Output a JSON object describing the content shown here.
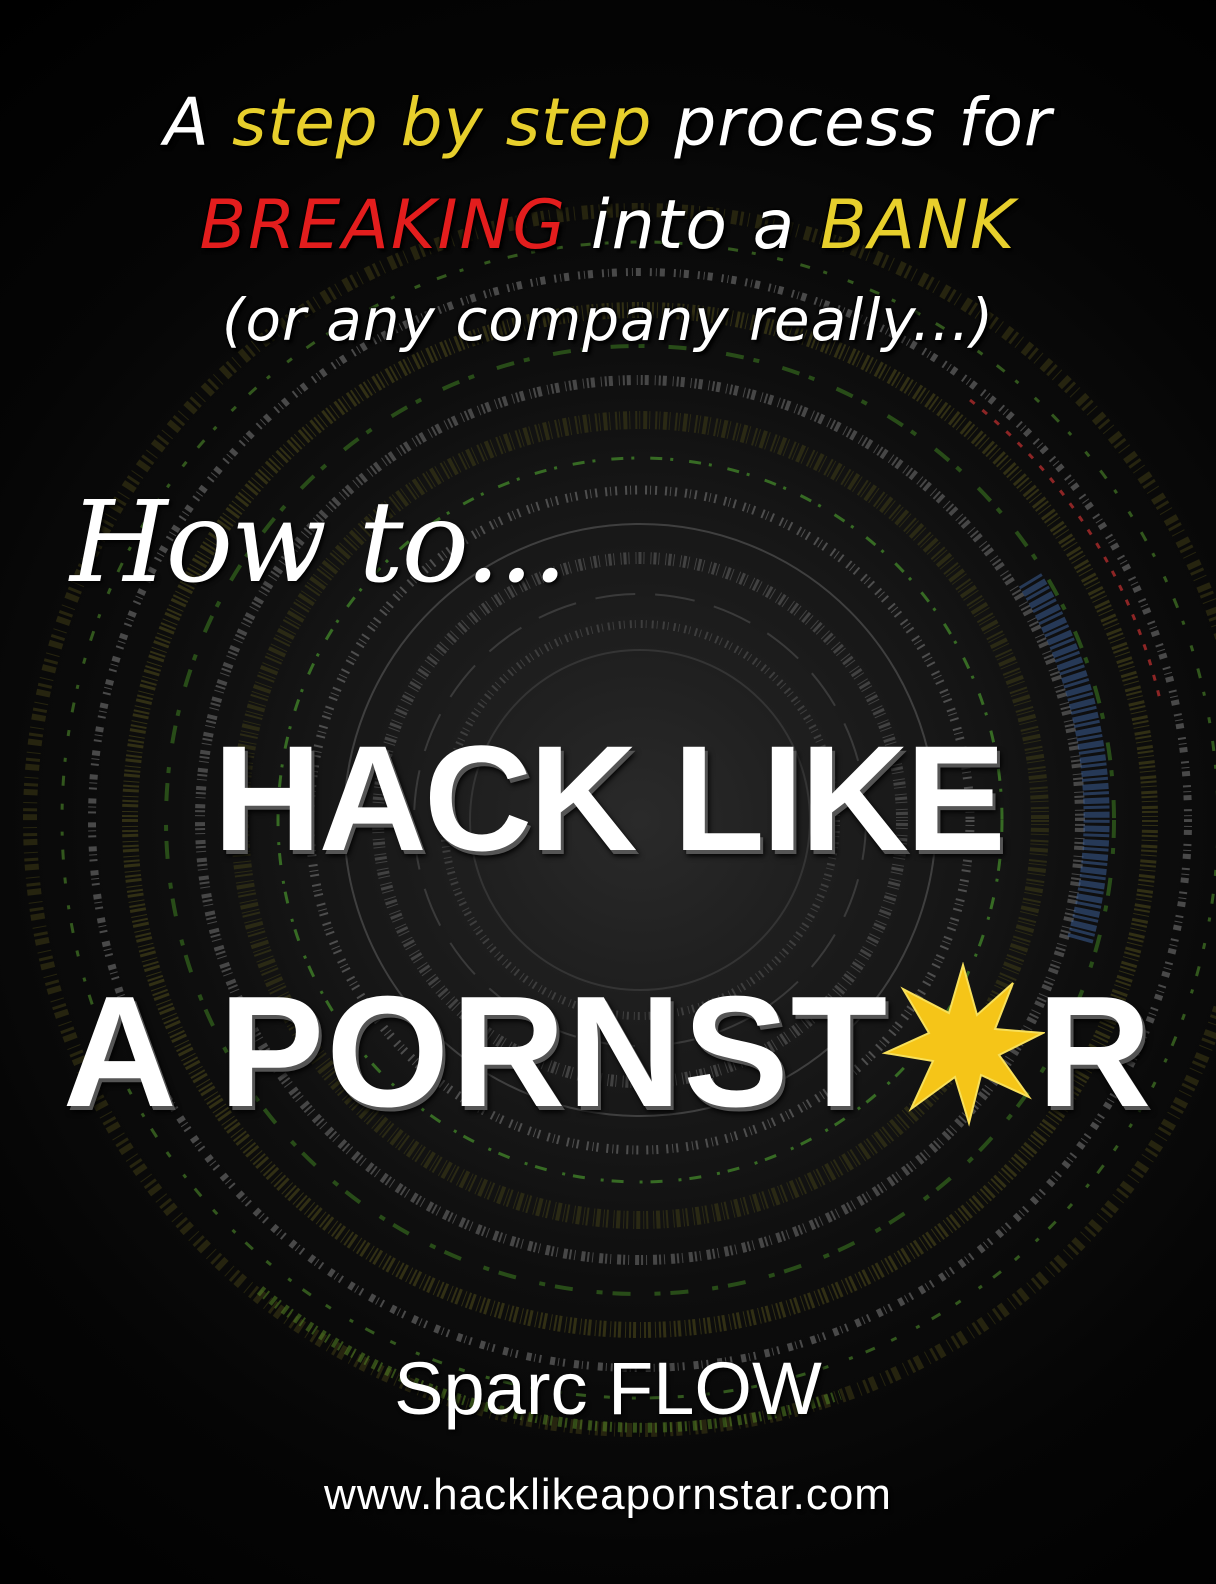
{
  "tagline": {
    "line1_prefix": "A ",
    "line1_highlight": "step by step",
    "line1_suffix": " process for",
    "line2_highlight_red": "BREAKING",
    "line2_middle": " into a ",
    "line2_highlight_yellow": "BANK",
    "line3": "(or any company really...)"
  },
  "title": {
    "how_to": "How to...",
    "line1": "HACK LIKE",
    "line2_before_star": "A PORNST",
    "line2_after_star": "R"
  },
  "author": "Sparc FLOW",
  "website": "www.hacklikeapornstar.com",
  "icons": {
    "star": "starburst-icon"
  },
  "colors": {
    "background": "#000000",
    "highlight_yellow": "#e7cf2c",
    "highlight_red": "#e31d1d",
    "star_fill": "#f5c518",
    "text": "#ffffff"
  }
}
